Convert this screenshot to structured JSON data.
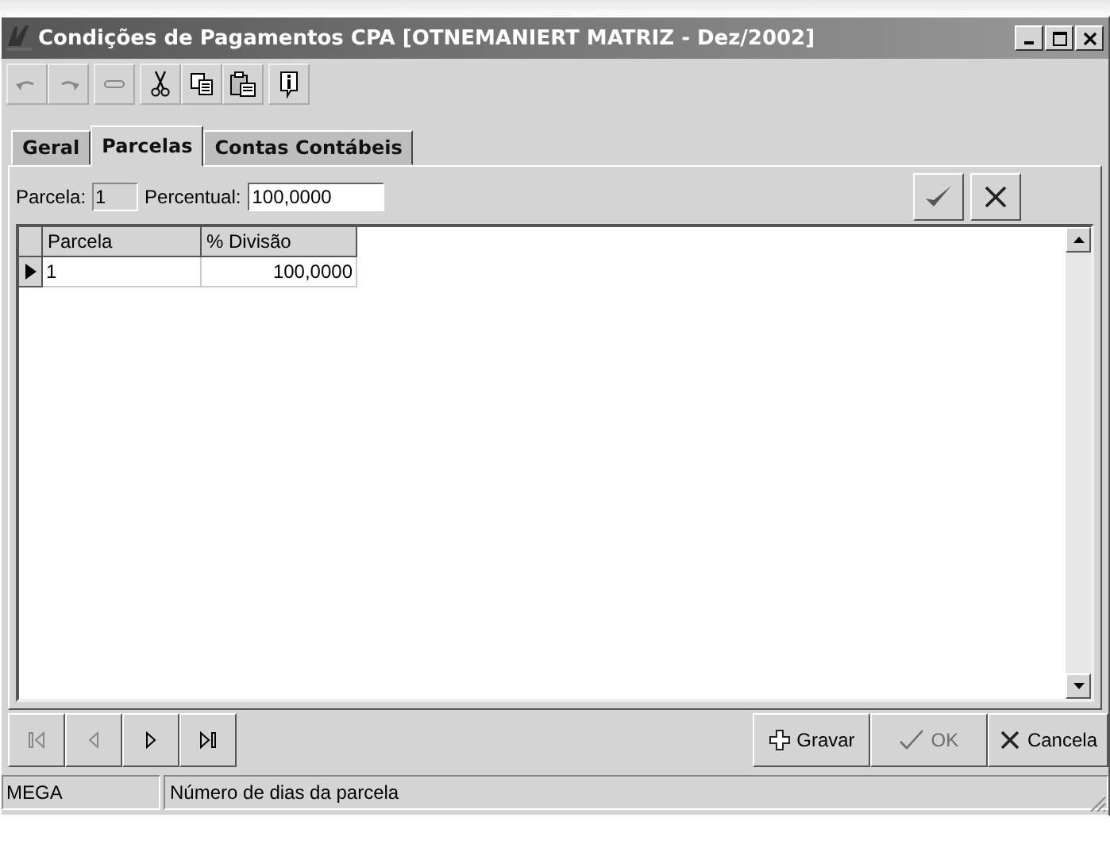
{
  "window": {
    "title": "Condições de Pagamentos CPA [OTNEMANIERT MATRIZ - Dez/2002]"
  },
  "toolbar": [
    {
      "kind": "undo",
      "disabled": true
    },
    {
      "kind": "redo",
      "disabled": true
    },
    {
      "kind": "minus",
      "disabled": true
    },
    {
      "kind": "cut",
      "disabled": false
    },
    {
      "kind": "copy",
      "disabled": false
    },
    {
      "kind": "paste",
      "disabled": false
    },
    {
      "kind": "info",
      "disabled": false
    }
  ],
  "tabs": [
    {
      "label": "Geral",
      "selected": false
    },
    {
      "label": "Parcelas",
      "selected": true
    },
    {
      "label": "Contas Contábeis",
      "selected": false
    }
  ],
  "fields": {
    "parcela_label": "Parcela:",
    "parcela_value": "1",
    "percentual_label": "Percentual:",
    "percentual_value": "100,0000"
  },
  "table": {
    "columns": [
      "Parcela",
      "% Divisão"
    ],
    "rows": [
      {
        "cells": [
          "1",
          "100,0000"
        ],
        "selected": true
      }
    ]
  },
  "navigator": [
    {
      "kind": "first",
      "disabled": true
    },
    {
      "kind": "prior",
      "disabled": true
    },
    {
      "kind": "next",
      "disabled": false
    },
    {
      "kind": "last",
      "disabled": false
    }
  ],
  "actions": [
    {
      "kind": "save",
      "label": "Gravar",
      "disabled": false
    },
    {
      "kind": "ok",
      "label": "OK",
      "disabled": true
    },
    {
      "kind": "cancel",
      "label": "Cancela",
      "disabled": false
    }
  ],
  "status_bar": {
    "left": "MEGA",
    "message": "Número de dias da parcela"
  }
}
